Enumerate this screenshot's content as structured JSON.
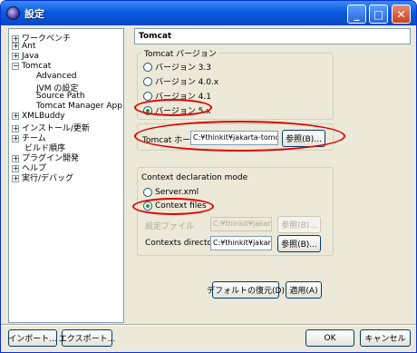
{
  "window": {
    "title": "設定",
    "minimize_glyph": "_",
    "maximize_glyph": "□",
    "close_glyph": "✕"
  },
  "tree": {
    "items": [
      {
        "label": "ワークベンチ",
        "expander": "+"
      },
      {
        "label": "Ant",
        "expander": "+"
      },
      {
        "label": "Java",
        "expander": "+"
      },
      {
        "label": "Tomcat",
        "expander": "−"
      },
      {
        "label": "Advanced",
        "expander": ""
      },
      {
        "label": "JVM の設定",
        "expander": ""
      },
      {
        "label": "Source Path",
        "expander": ""
      },
      {
        "label": "Tomcat Manager App",
        "expander": ""
      },
      {
        "label": "XMLBuddy",
        "expander": "+"
      },
      {
        "label": "インストール/更新",
        "expander": "+"
      },
      {
        "label": "チーム",
        "expander": "+"
      },
      {
        "label": "ビルド順序",
        "expander": ""
      },
      {
        "label": "プラグイン開発",
        "expander": "+"
      },
      {
        "label": "ヘルプ",
        "expander": "+"
      },
      {
        "label": "実行/デバッグ",
        "expander": "+"
      }
    ]
  },
  "page": {
    "title": "Tomcat",
    "version_group": {
      "label": "Tomcat バージョン",
      "options": [
        "バージョン 3.3",
        "バージョン 4.0.x",
        "バージョン 4.1",
        "バージョン 5.x"
      ],
      "selected": "バージョン 5.x"
    },
    "home": {
      "label": "Tomcat ホーム",
      "value": "C:¥thinkit¥jakarta-tomca",
      "browse": "参照(B)..."
    },
    "context_group": {
      "label": "Context declaration mode",
      "options": [
        "Server.xml",
        "Context files"
      ],
      "selected": "Context files",
      "config_file_label": "設定ファイル",
      "config_file_value": "C:¥thinkit¥jakarta",
      "config_browse": "参照(B)...",
      "contexts_dir_label": "Contexts directory",
      "contexts_dir_value": "C:¥thinkit¥jakarta",
      "contexts_browse": "参照(B)..."
    },
    "restore_defaults": "デフォルトの復元(D)",
    "apply": "適用(A)"
  },
  "footer": {
    "import": "インポート...",
    "export": "エクスポート...",
    "ok": "OK",
    "cancel": "キャンセル"
  },
  "colors": {
    "annotation": "#e00000",
    "titlebar": "#0a5be0",
    "selected_radio": "#21a121"
  }
}
